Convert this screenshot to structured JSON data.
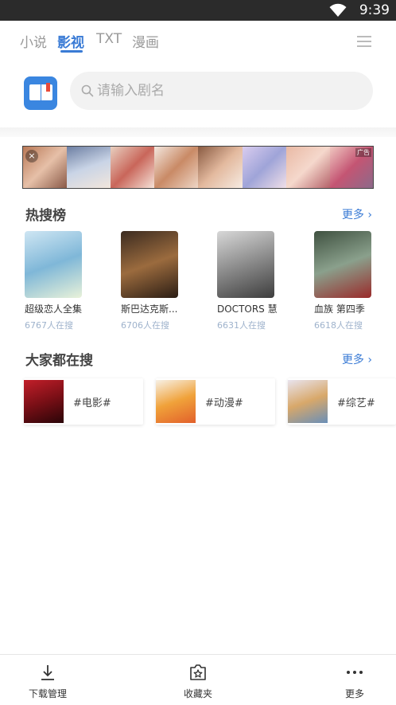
{
  "status_bar": {
    "time": "9:39",
    "wifi_icon": "wifi-icon"
  },
  "tabs": [
    {
      "label": "小说",
      "active": false
    },
    {
      "label": "影视",
      "active": true
    },
    {
      "label": "TXT",
      "active": false
    },
    {
      "label": "漫画",
      "active": false
    }
  ],
  "menu_icon": "hamburger-menu-icon",
  "search": {
    "placeholder": "请输入剧名",
    "value": "",
    "icon": "search-icon"
  },
  "banner": {
    "close_label": "×",
    "ad_tag": "广告"
  },
  "hot_section": {
    "title": "热搜榜",
    "more": "更多 ›",
    "items": [
      {
        "name": "超级恋人全集",
        "count": "6767人在搜"
      },
      {
        "name": "斯巴达克斯...",
        "count": "6706人在搜"
      },
      {
        "name": "DOCTORS 慧",
        "count": "6631人在搜"
      },
      {
        "name": "血族 第四季",
        "count": "6618人在搜"
      }
    ]
  },
  "popular_section": {
    "title": "大家都在搜",
    "more": "更多 ›",
    "cards": [
      {
        "label": "#电影#"
      },
      {
        "label": "#动漫#"
      },
      {
        "label": "#综艺#"
      }
    ]
  },
  "bottom_nav": [
    {
      "label": "下载管理",
      "icon": "download-icon"
    },
    {
      "label": "收藏夹",
      "icon": "favorites-star-icon"
    },
    {
      "label": "更多",
      "icon": "more-dots-icon"
    }
  ],
  "colors": {
    "accent": "#3a7bd5",
    "logo": "#3a86e0",
    "count_text": "#9fb3cc"
  }
}
